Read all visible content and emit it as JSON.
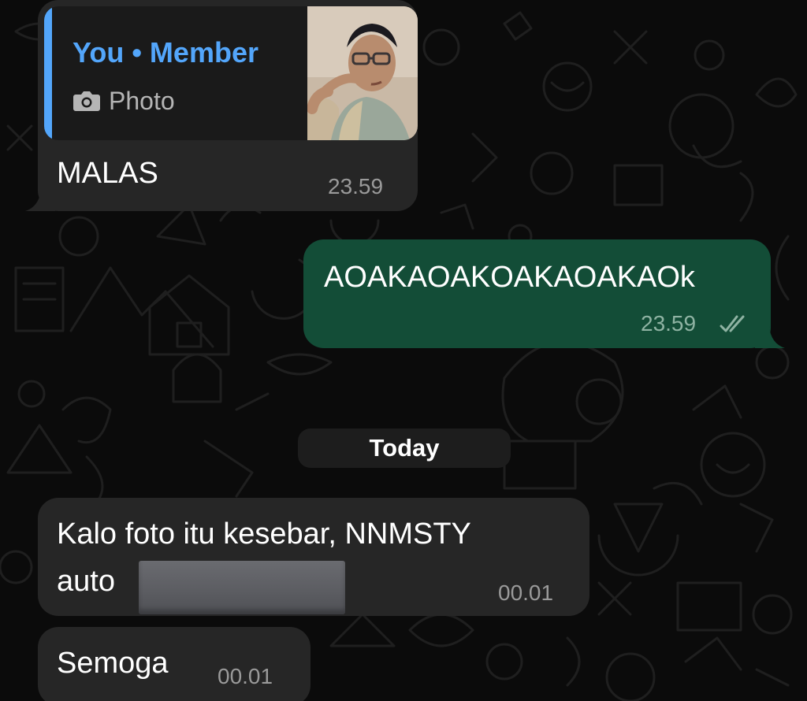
{
  "messages": {
    "reply": {
      "quote_author": "You • Member",
      "quote_type_icon": "camera-icon",
      "quote_type": "Photo",
      "text": "MALAS",
      "time": "23.59"
    },
    "sent": {
      "text": "AOAKAOAKOAKAOAKAOk",
      "time": "23.59",
      "status_icon": "double-check-icon"
    },
    "date_separator": "Today",
    "redacted": {
      "line1": "Kalo foto itu kesebar, NNMSTY",
      "line2": "auto",
      "time": "00.01"
    },
    "last": {
      "text": "Semoga",
      "time": "00.01"
    }
  },
  "colors": {
    "incoming_bubble": "#262626",
    "outgoing_bubble": "#134d37",
    "quote_accent": "#53a6fb",
    "background": "#0b0b0b"
  }
}
